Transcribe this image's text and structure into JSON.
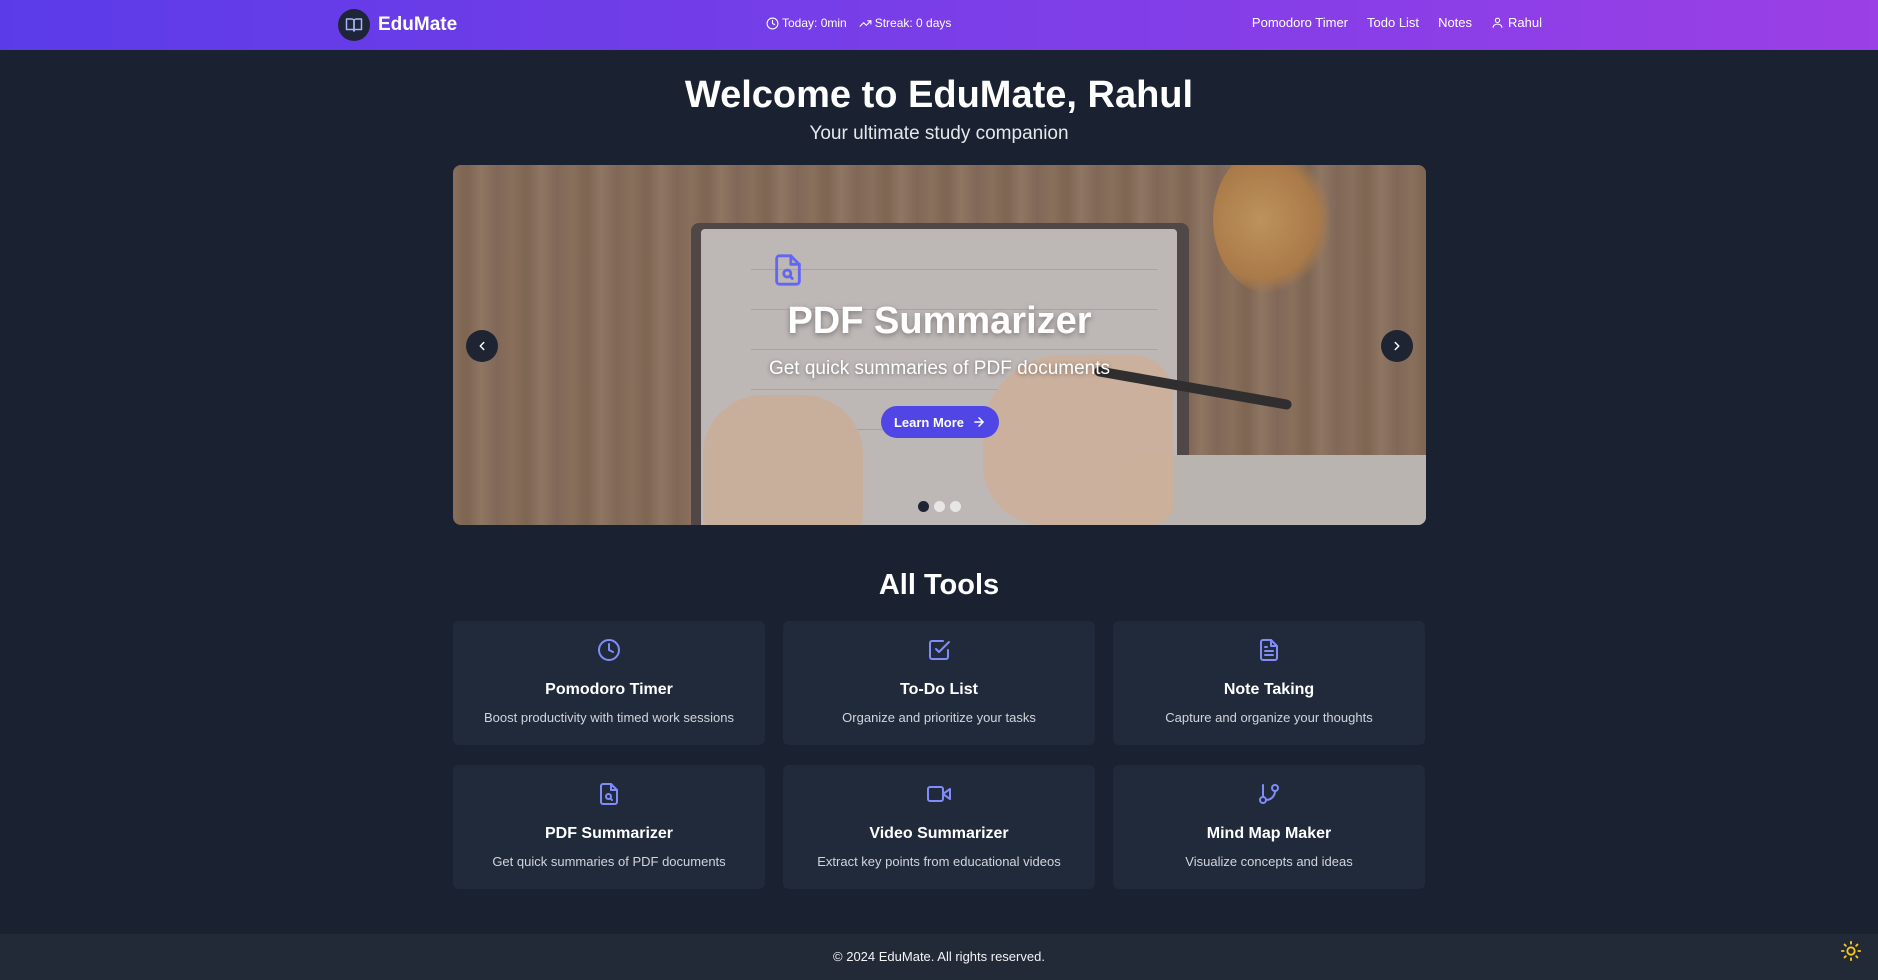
{
  "header": {
    "brand": "EduMate",
    "stats": {
      "today": "Today: 0min",
      "streak": "Streak: 0 days"
    },
    "nav": {
      "pomodoro": "Pomodoro Timer",
      "todo": "Todo List",
      "notes": "Notes",
      "user": "Rahul"
    }
  },
  "hero": {
    "title": "Welcome to EduMate, Rahul",
    "subtitle": "Your ultimate study companion"
  },
  "carousel": {
    "slide_title": "PDF Summarizer",
    "slide_description": "Get quick summaries of PDF documents",
    "button_label": "Learn More",
    "icon": "file-search-icon",
    "dots_count": 3,
    "active_dot": 1
  },
  "tools": {
    "heading": "All Tools",
    "items": [
      {
        "title": "Pomodoro Timer",
        "description": "Boost productivity with timed work sessions",
        "icon": "clock-icon"
      },
      {
        "title": "To-Do List",
        "description": "Organize and prioritize your tasks",
        "icon": "checkbox-icon"
      },
      {
        "title": "Note Taking",
        "description": "Capture and organize your thoughts",
        "icon": "document-icon"
      },
      {
        "title": "PDF Summarizer",
        "description": "Get quick summaries of PDF documents",
        "icon": "file-search-icon"
      },
      {
        "title": "Video Summarizer",
        "description": "Extract key points from educational videos",
        "icon": "video-icon"
      },
      {
        "title": "Mind Map Maker",
        "description": "Visualize concepts and ideas",
        "icon": "branch-icon"
      }
    ]
  },
  "footer": {
    "text": "© 2024 EduMate. All rights reserved."
  },
  "colors": {
    "accent": "#4f46e5",
    "icon": "#818cf8",
    "background": "#1a2232",
    "card": "#212a3b",
    "header_start": "#5b3be8",
    "header_end": "#9b3fe6",
    "toggle": "#facc15"
  }
}
